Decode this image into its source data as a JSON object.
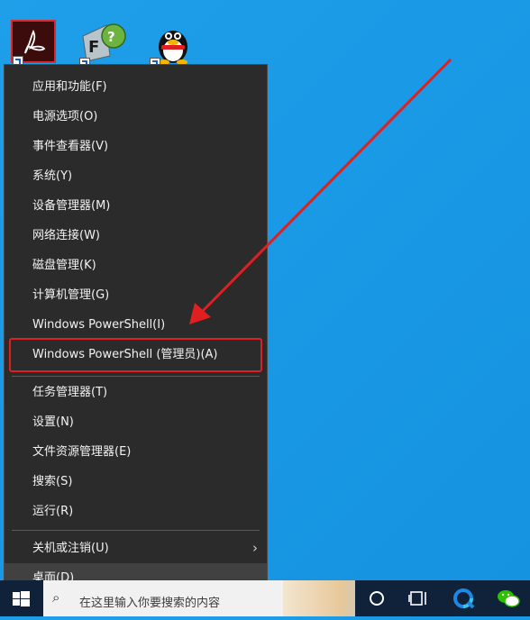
{
  "desktop": {
    "icons": [
      {
        "name": "acrobat-icon",
        "label": ""
      },
      {
        "name": "foxit-icon",
        "label": ""
      },
      {
        "name": "qq-icon",
        "label": ""
      }
    ]
  },
  "context_menu": {
    "items": [
      {
        "label": "应用和功能(F)"
      },
      {
        "label": "电源选项(O)"
      },
      {
        "label": "事件查看器(V)"
      },
      {
        "label": "系统(Y)"
      },
      {
        "label": "设备管理器(M)"
      },
      {
        "label": "网络连接(W)"
      },
      {
        "label": "磁盘管理(K)"
      },
      {
        "label": "计算机管理(G)"
      },
      {
        "label": "Windows PowerShell(I)"
      },
      {
        "label": "Windows PowerShell (管理员)(A)"
      },
      {
        "label": "任务管理器(T)"
      },
      {
        "label": "设置(N)"
      },
      {
        "label": "文件资源管理器(E)"
      },
      {
        "label": "搜索(S)"
      },
      {
        "label": "运行(R)"
      },
      {
        "label": "关机或注销(U)"
      },
      {
        "label": "桌面(D)"
      }
    ],
    "highlighted_item": "桌面(D)",
    "annotated_item": "Windows PowerShell (管理员)(A)"
  },
  "taskbar": {
    "search_placeholder": "在这里输入你要搜索的内容",
    "icons": [
      "start-icon",
      "search-icon",
      "cortana-icon",
      "task-view-icon",
      "browser-icon",
      "wechat-icon"
    ]
  },
  "colors": {
    "desktop": "#1a9ae6",
    "menu_bg": "#2b2b2b",
    "menu_text": "#f2f2f2",
    "annotation": "#e02020",
    "taskbar": "#10223a"
  }
}
